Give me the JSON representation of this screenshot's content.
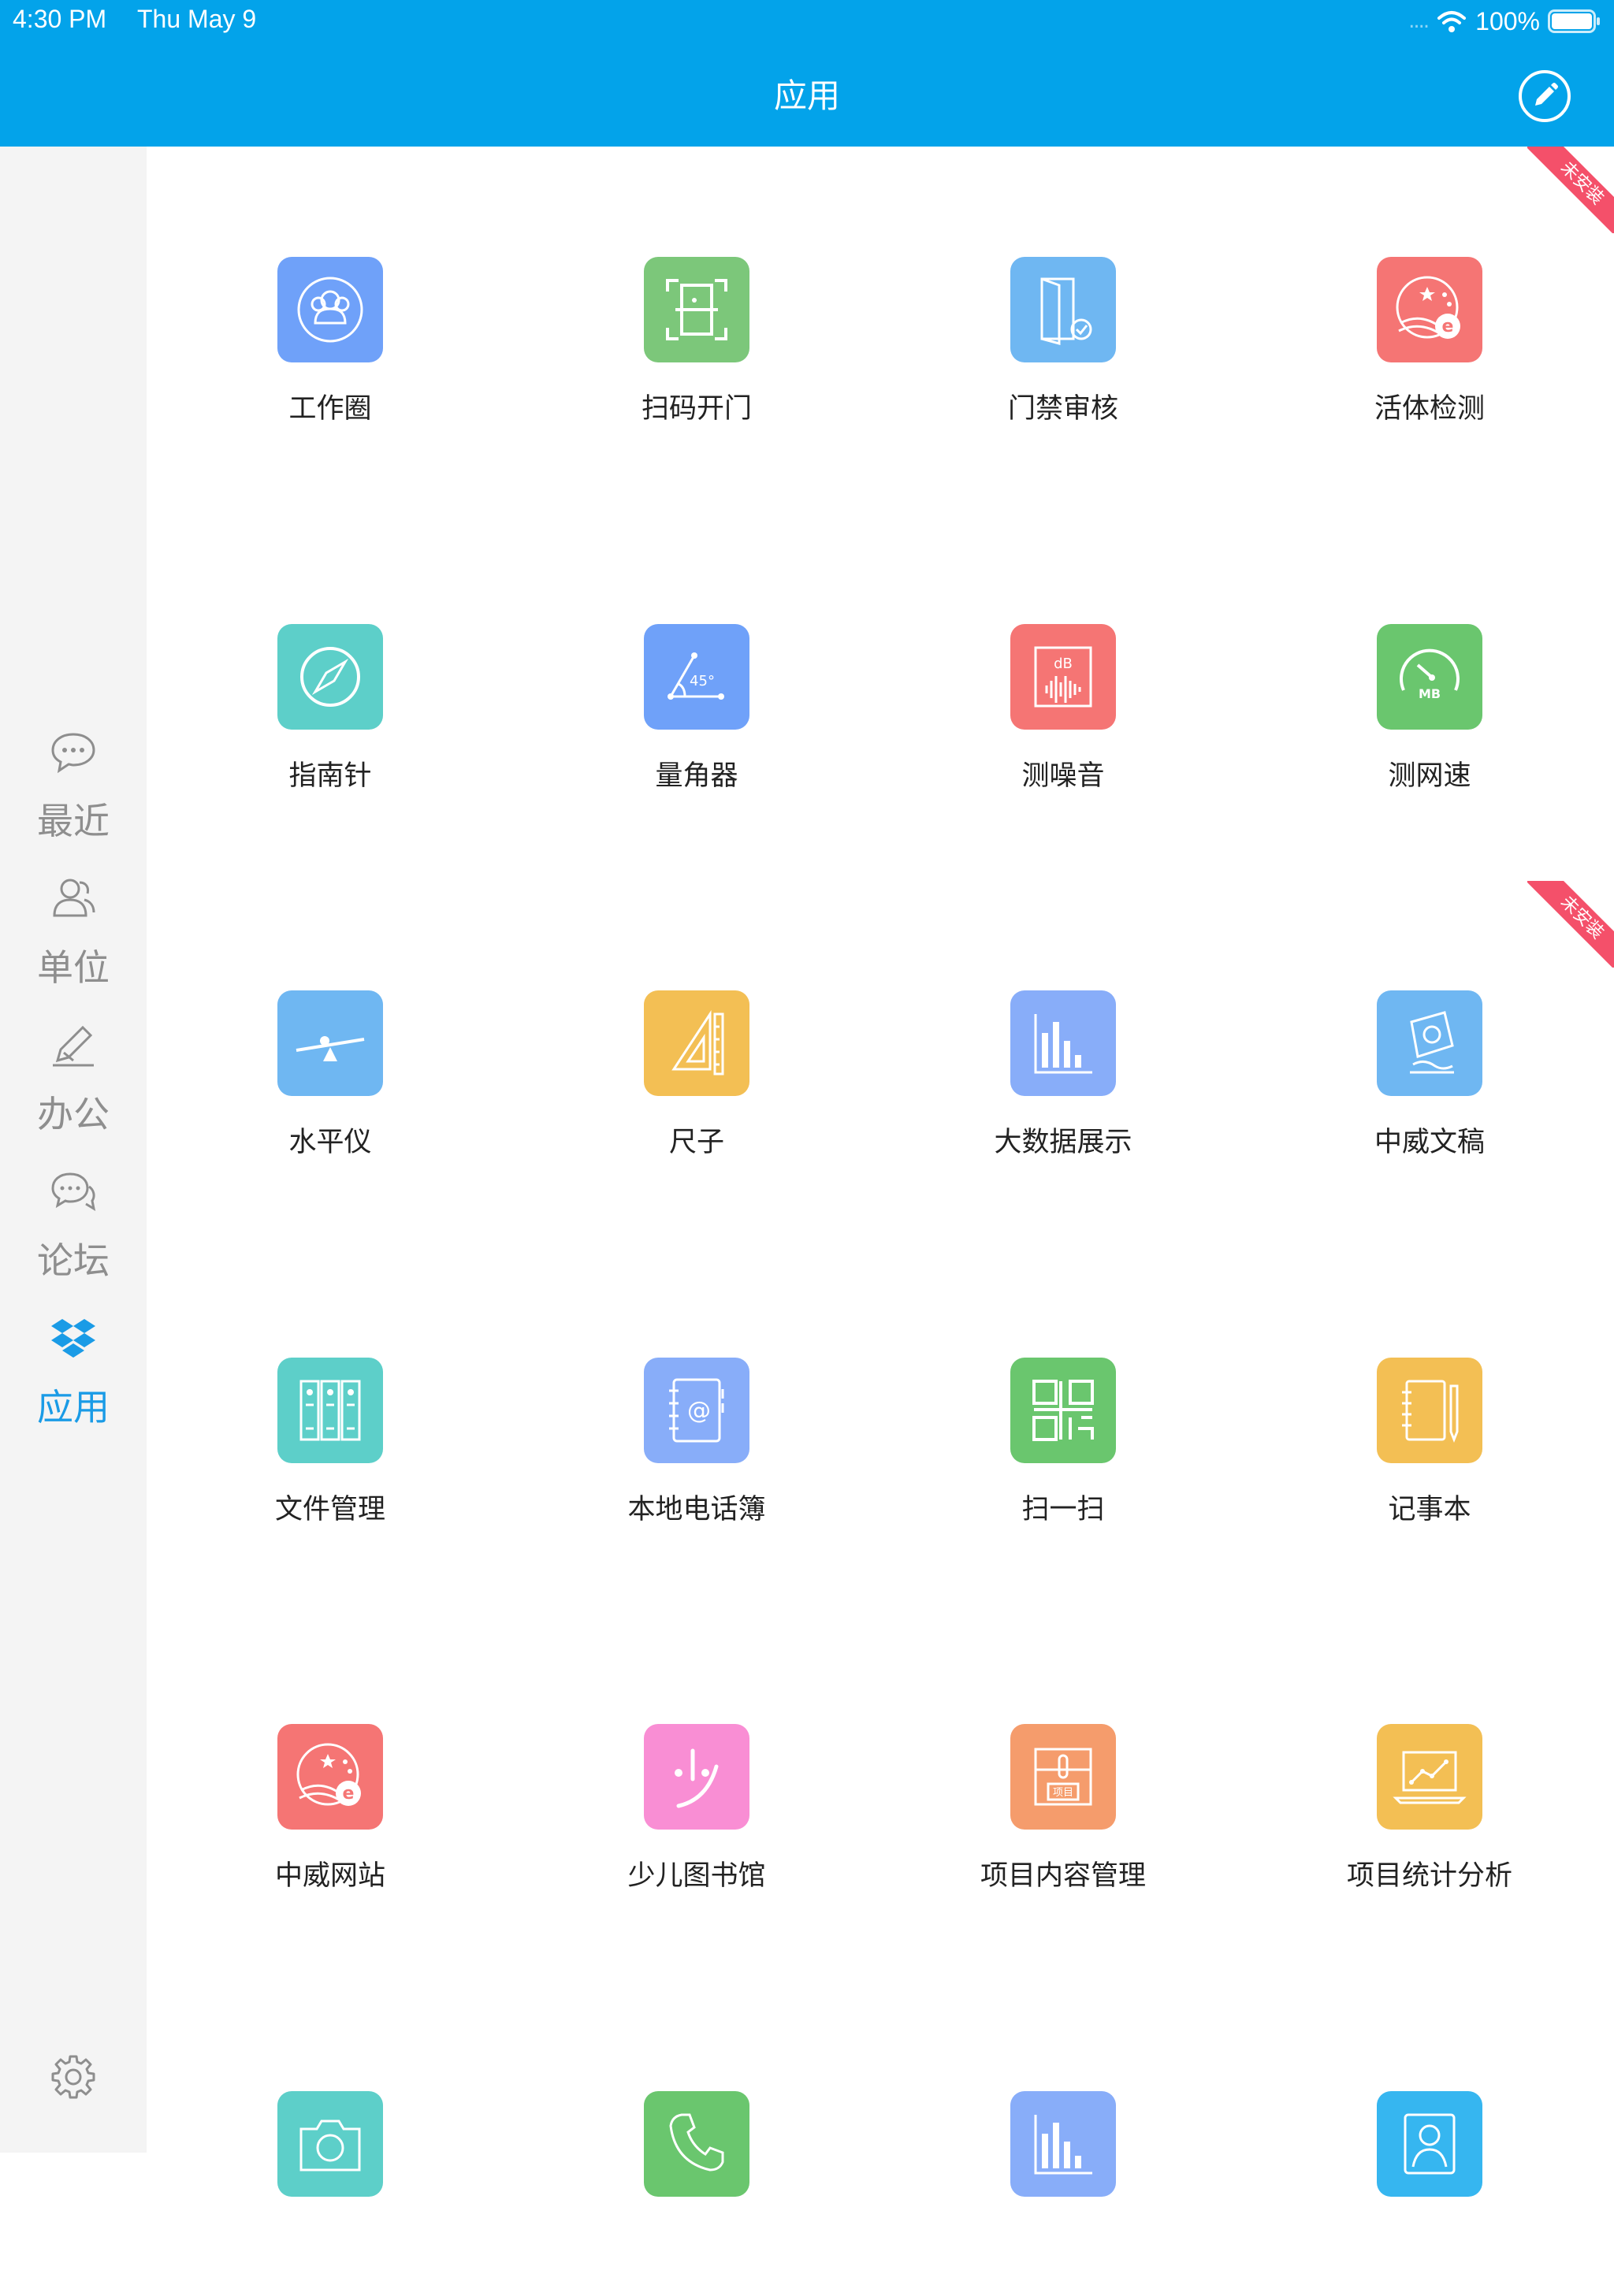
{
  "status_bar": {
    "time": "4:30 PM",
    "date": "Thu May 9",
    "signal": "....",
    "battery": "100%"
  },
  "header": {
    "title": "应用",
    "edit_icon": "pencil-circle-icon"
  },
  "sidebar": {
    "items": [
      {
        "label": "最近",
        "icon": "chat-bubble-icon",
        "active": false
      },
      {
        "label": "单位",
        "icon": "users-icon",
        "active": false
      },
      {
        "label": "办公",
        "icon": "pen-icon",
        "active": false
      },
      {
        "label": "论坛",
        "icon": "forum-icon",
        "active": false
      },
      {
        "label": "应用",
        "icon": "dropbox-icon",
        "active": true
      }
    ],
    "settings_icon": "gear-icon",
    "active_color": "#1a9be6"
  },
  "ribbon_label": "未安装",
  "apps": [
    {
      "label": "工作圈",
      "color": "#6fa1f9",
      "icon": "people-circle-icon"
    },
    {
      "label": "扫码开门",
      "color": "#7cc77a",
      "icon": "scan-door-icon"
    },
    {
      "label": "门禁审核",
      "color": "#6fb7f2",
      "icon": "door-check-icon"
    },
    {
      "label": "活体检测",
      "color": "#f57574",
      "icon": "ie-globe-icon"
    },
    {
      "label": "指南针",
      "color": "#5dcfc9",
      "icon": "compass-icon"
    },
    {
      "label": "量角器",
      "color": "#6fa1f9",
      "icon": "protractor-icon"
    },
    {
      "label": "测噪音",
      "color": "#f57574",
      "icon": "decibel-icon"
    },
    {
      "label": "测网速",
      "color": "#6ac66e",
      "icon": "speedometer-icon"
    },
    {
      "label": "水平仪",
      "color": "#6fb7f2",
      "icon": "level-icon"
    },
    {
      "label": "尺子",
      "color": "#f3bf54",
      "icon": "ruler-icon"
    },
    {
      "label": "大数据展示",
      "color": "#88adf9",
      "icon": "bar-chart-icon"
    },
    {
      "label": "中威文稿",
      "color": "#6fb7f2",
      "icon": "document-icon"
    },
    {
      "label": "文件管理",
      "color": "#5dcfc9",
      "icon": "binders-icon"
    },
    {
      "label": "本地电话簿",
      "color": "#88adf9",
      "icon": "address-book-icon"
    },
    {
      "label": "扫一扫",
      "color": "#6ac66e",
      "icon": "qr-code-icon"
    },
    {
      "label": "记事本",
      "color": "#f3bf54",
      "icon": "notebook-icon"
    },
    {
      "label": "中威网站",
      "color": "#f57574",
      "icon": "ie-globe-icon"
    },
    {
      "label": "少儿图书馆",
      "color": "#f98ed4",
      "icon": "kid-library-icon"
    },
    {
      "label": "项目内容管理",
      "color": "#f59c6c",
      "icon": "project-box-icon"
    },
    {
      "label": "项目统计分析",
      "color": "#f3bf54",
      "icon": "laptop-chart-icon"
    },
    {
      "label": "",
      "color": "#5dcfc9",
      "icon": "camera-icon"
    },
    {
      "label": "",
      "color": "#6ac66e",
      "icon": "phone-icon"
    },
    {
      "label": "",
      "color": "#88adf9",
      "icon": "bar-chart-icon"
    },
    {
      "label": "",
      "color": "#36b6f0",
      "icon": "contact-card-icon"
    }
  ]
}
